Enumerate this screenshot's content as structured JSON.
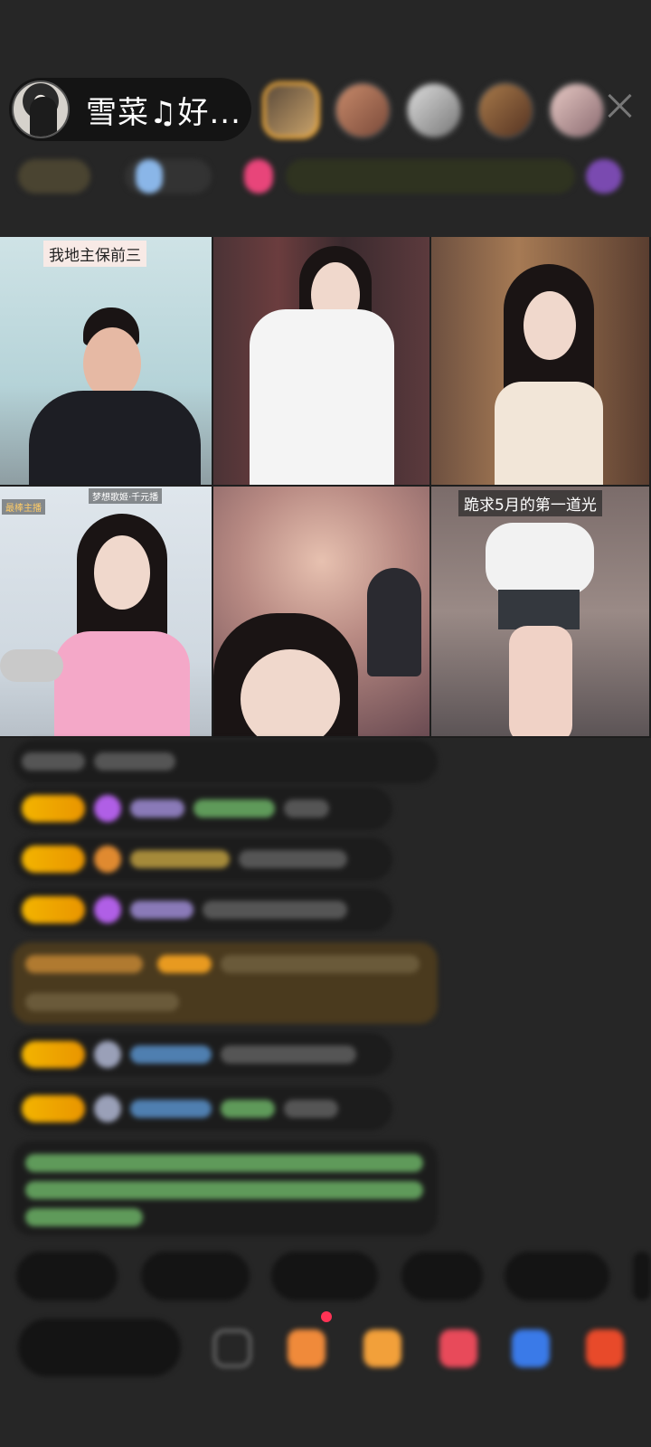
{
  "header": {
    "host_name": "雪菜♫好...",
    "close_icon": "close-icon",
    "viewer_count": 5
  },
  "grid": {
    "tiles": [
      {
        "label": "我地主保前三"
      },
      {
        "label": ""
      },
      {
        "label": ""
      },
      {
        "label": "",
        "small_left": "最棒主播",
        "small_right": "梦想歌姬·千元播"
      },
      {
        "label": ""
      },
      {
        "label": "跪求5月的第一道光"
      }
    ]
  },
  "bottom": {
    "icons": [
      "grid-icon",
      "gift-box-icon",
      "treasure-icon",
      "heart-icon",
      "chat-bubble-icon",
      "gift-icon"
    ]
  }
}
